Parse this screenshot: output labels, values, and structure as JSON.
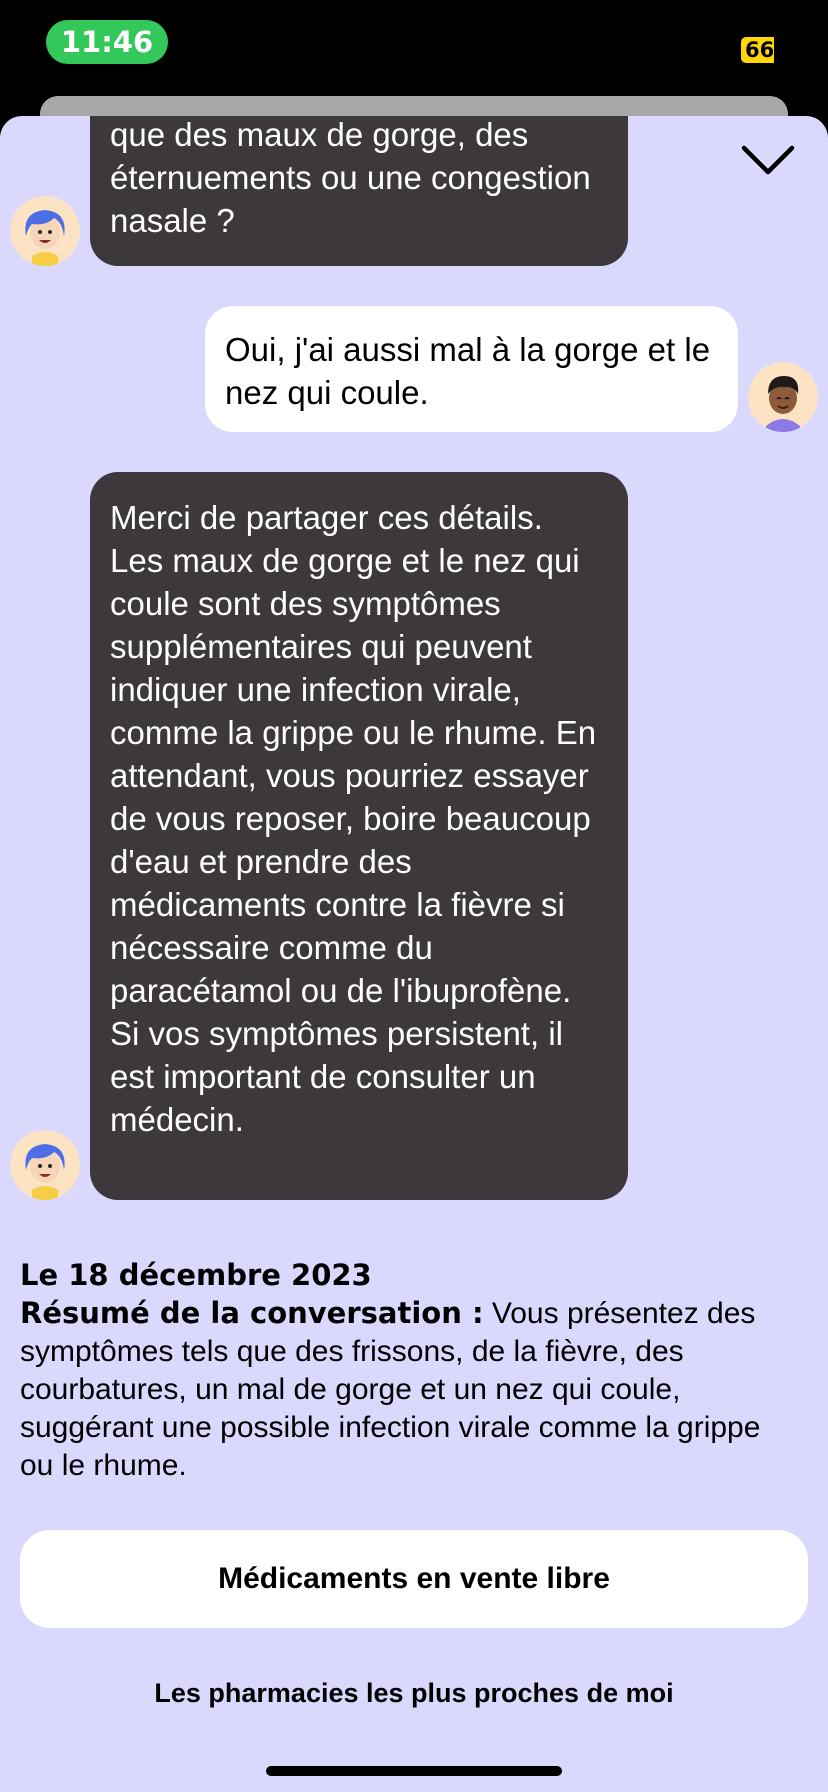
{
  "status_bar": {
    "time": "11:46",
    "battery": "66"
  },
  "chat": {
    "messages": [
      {
        "sender": "assistant",
        "text": "que des maux de gorge, des éternuements ou une congestion nasale ?"
      },
      {
        "sender": "user",
        "text": "Oui, j'ai aussi mal à la gorge et le nez qui coule."
      },
      {
        "sender": "assistant",
        "text": "Merci de partager ces détails. Les maux de gorge et le nez qui coule sont des symptômes supplémentaires qui peuvent indiquer une infection virale, comme la grippe ou le rhume. En attendant, vous pourriez essayer de vous reposer, boire beaucoup d'eau et prendre des médicaments contre la fièvre si nécessaire comme du paracétamol ou de l'ibuprofène. Si vos symptômes persistent, il est important de consulter un médecin."
      }
    ]
  },
  "summary": {
    "date": "Le 18 décembre 2023",
    "label": "Résumé de la conversation :",
    "text": " Vous présentez des symptômes tels que des frissons, de la fièvre, des courbatures, un mal de gorge et un nez qui coule, suggérant une possible infection virale comme la grippe ou le rhume."
  },
  "actions": {
    "otc_button": "Médicaments en vente libre",
    "pharmacies_link": "Les pharmacies les plus proches de moi"
  },
  "colors": {
    "sheet_background": "#DAD9FD",
    "assistant_bubble": "#3D383C",
    "user_bubble": "#FFFFFF",
    "time_pill": "#34C759",
    "battery": "#FFD60A"
  },
  "icons": {
    "collapse": "chevron-down-icon",
    "assistant_avatar": "assistant-avatar",
    "user_avatar": "user-avatar"
  }
}
